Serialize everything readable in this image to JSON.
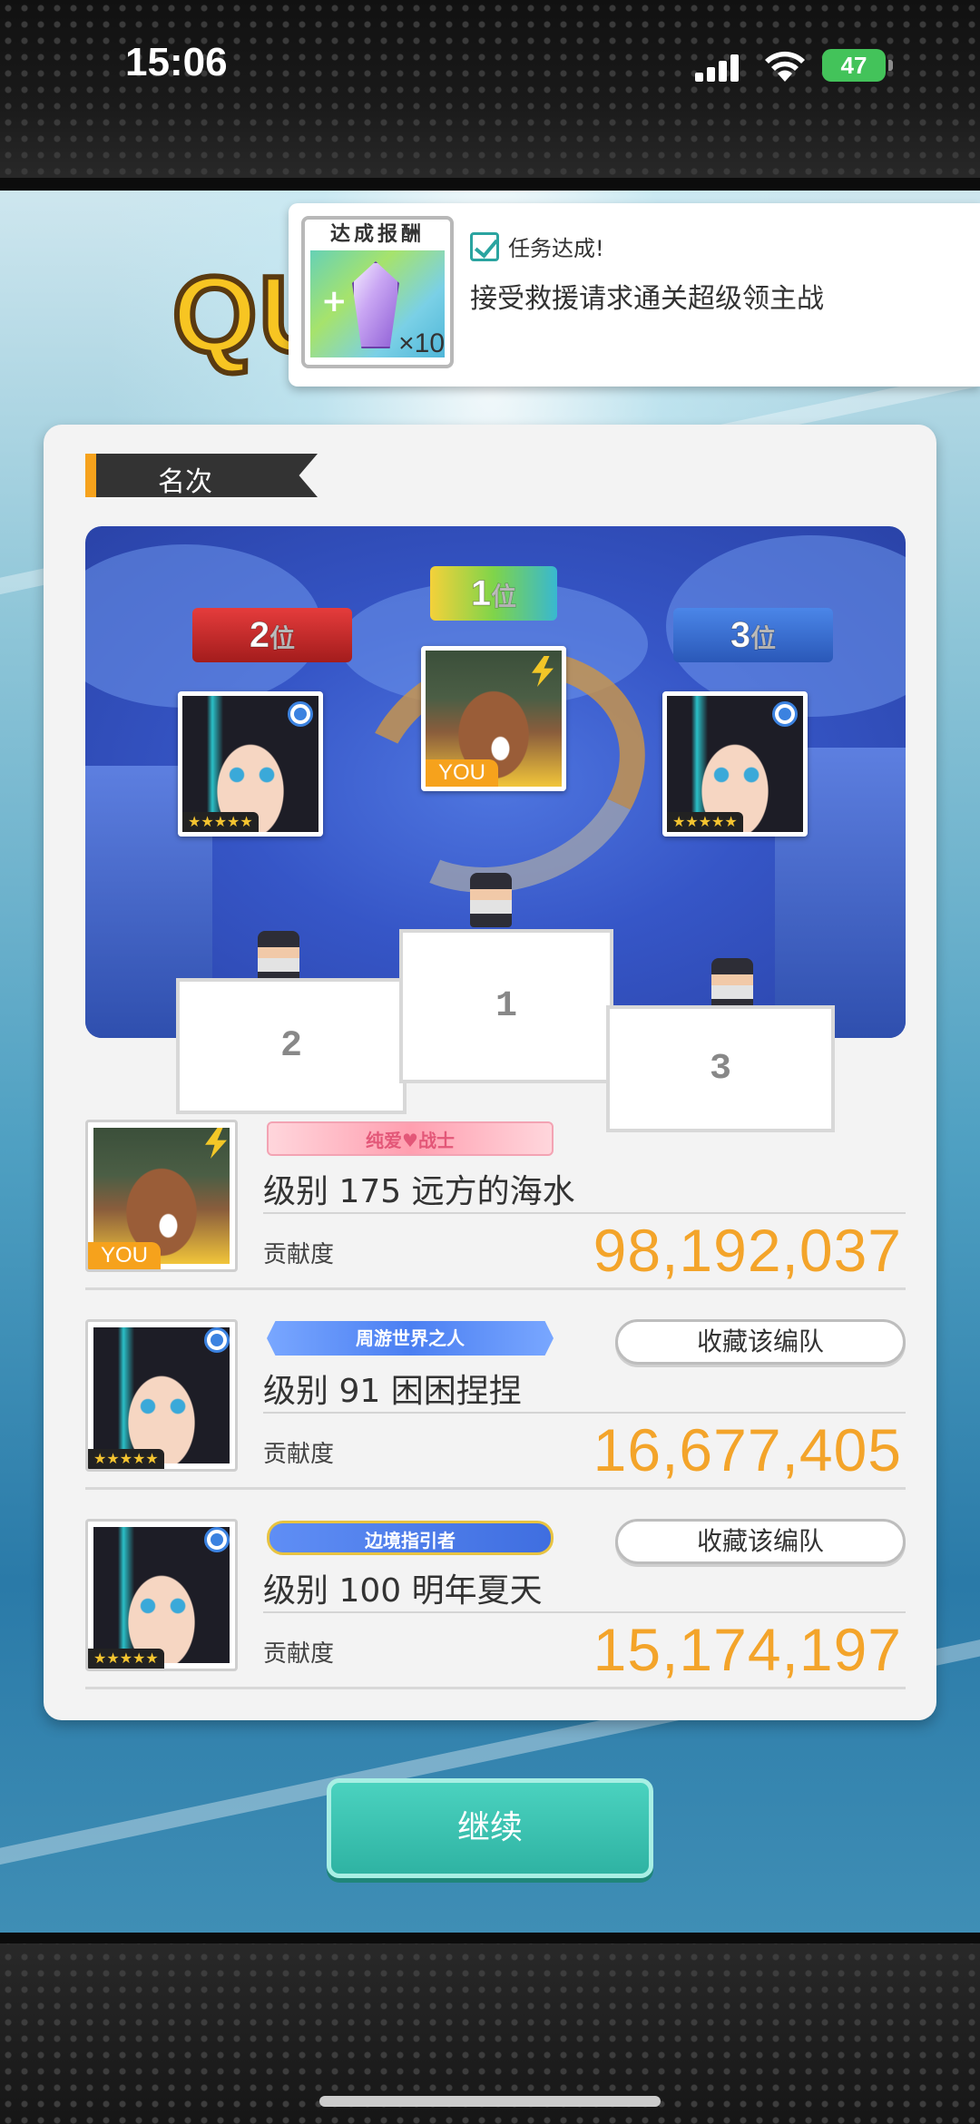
{
  "status_bar": {
    "time": "15:06",
    "battery": "47"
  },
  "background": {
    "quest_title_partial": "QU"
  },
  "notification": {
    "reward_label": "达成报酬",
    "reward_quantity": "×10",
    "status": "任务达成!",
    "text": "接受救援请求通关超级领主战"
  },
  "panel": {
    "section_title": "名次"
  },
  "podium": {
    "first": {
      "rank_label": "1",
      "rank_suffix": "位",
      "tag": "YOU",
      "base_number": "1"
    },
    "second": {
      "rank_label": "2",
      "rank_suffix": "位",
      "stars": "★★★★★",
      "base_number": "2"
    },
    "third": {
      "rank_label": "3",
      "rank_suffix": "位",
      "stars": "★★★★★",
      "base_number": "3"
    }
  },
  "rankings": [
    {
      "title_badge": "纯爱♥战士",
      "name": "级别 175 远方的海水",
      "label": "贡献度",
      "score": "98,192,037",
      "tag": "YOU"
    },
    {
      "title_badge": "周游世界之人",
      "name": "级别 91 困困捏捏",
      "label": "贡献度",
      "score": "16,677,405",
      "stars": "★★★★★",
      "button": "收藏该编队"
    },
    {
      "title_badge": "边境指引者",
      "name": "级别 100 明年夏天",
      "label": "贡献度",
      "score": "15,174,197",
      "stars": "★★★★★",
      "button": "收藏该编队"
    }
  ],
  "continue_button": "继续",
  "colors": {
    "accent_orange": "#f3a42a",
    "continue_teal": "#2fb3a3",
    "podium_blue": "#3656c7"
  }
}
